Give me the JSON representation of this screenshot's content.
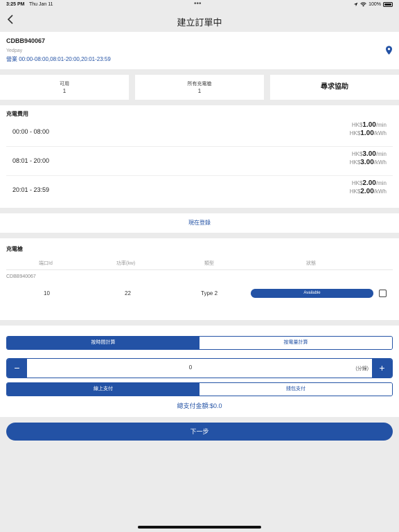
{
  "status_bar": {
    "time": "3:25 PM",
    "date": "Thu Jan 11",
    "dots": "•••",
    "battery": "100%"
  },
  "nav": {
    "back_icon": "chevron-left-icon",
    "title": "建立訂單中"
  },
  "station": {
    "id": "CDBB940067",
    "operator": "Yedpay",
    "hours": "營業 00:00-08:00,08:01-20:00,20:01-23:59",
    "pin_icon": "location-pin-icon"
  },
  "stats": {
    "available_label": "可用",
    "available_value": "1",
    "all_label": "所有充電槍",
    "all_value": "1",
    "help_label": "尋求協助"
  },
  "fees": {
    "title": "充電費用",
    "rows": [
      {
        "range": "00:00 - 08:00",
        "cur1": "HK$",
        "per_min": "1.00",
        "unit1": "/min",
        "cur2": "HK$",
        "per_kwh": "1.00",
        "unit2": "/kWh"
      },
      {
        "range": "08:01 - 20:00",
        "cur1": "HK$",
        "per_min": "3.00",
        "unit1": "/min",
        "cur2": "HK$",
        "per_kwh": "3.00",
        "unit2": "/kWh"
      },
      {
        "range": "20:01 - 23:59",
        "cur1": "HK$",
        "per_min": "2.00",
        "unit1": "/min",
        "cur2": "HK$",
        "per_kwh": "2.00",
        "unit2": "/kWh"
      }
    ]
  },
  "register_label": "現在登錄",
  "connectors": {
    "title": "充電槍",
    "headers": [
      "端口Id",
      "功率(kw)",
      "類型",
      "狀態"
    ],
    "station_id": "CDBB940067",
    "row": {
      "port": "10",
      "power": "22",
      "type": "Type 2",
      "status": "Available"
    }
  },
  "payment": {
    "mode_tabs": [
      "按時間計算",
      "按電量計算"
    ],
    "stepper_value": "0",
    "stepper_unit": "(分鐘)",
    "minus": "−",
    "plus": "+",
    "pay_tabs": [
      "線上支付",
      "錢包支付"
    ],
    "total": "總支付金額:$0.0"
  },
  "next_label": "下一步",
  "colors": {
    "accent": "#2352a5",
    "background": "#ebebeb"
  }
}
